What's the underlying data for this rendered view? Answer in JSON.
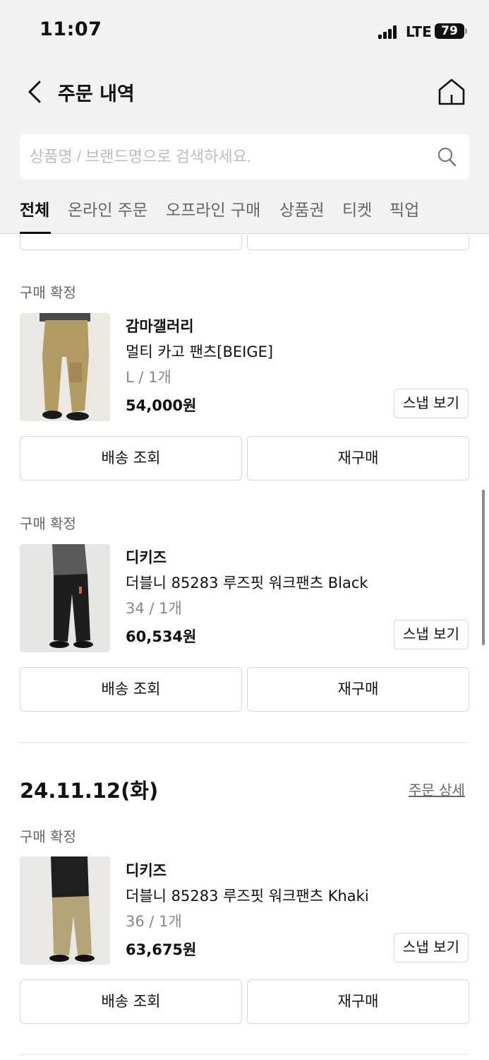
{
  "status_bar": {
    "time": "11:07",
    "network": "LTE",
    "battery": "79"
  },
  "header": {
    "title": "주문 내역"
  },
  "search": {
    "placeholder": "상품명 / 브랜드명으로 검색하세요."
  },
  "tabs": [
    {
      "label": "전체",
      "active": true
    },
    {
      "label": "온라인 주문",
      "active": false
    },
    {
      "label": "오프라인 구매",
      "active": false
    },
    {
      "label": "상품권",
      "active": false
    },
    {
      "label": "티켓",
      "active": false
    },
    {
      "label": "픽업",
      "active": false
    }
  ],
  "items": [
    {
      "status": "구매 확정",
      "brand": "감마갤러리",
      "name": "멀티 카고 팬츠[BEIGE]",
      "option": "L / 1개",
      "price": "54,000원",
      "snap_label": "스냅 보기",
      "track_label": "배송 조회",
      "rebuy_label": "재구매"
    },
    {
      "status": "구매 확정",
      "brand": "디키즈",
      "name": "더블니 85283 루즈핏 워크팬츠 Black",
      "option": "34 / 1개",
      "price": "60,534원",
      "snap_label": "스냅 보기",
      "track_label": "배송 조회",
      "rebuy_label": "재구매"
    }
  ],
  "order_group": {
    "date": "24.11.12(화)",
    "detail_label": "주문 상세",
    "items": [
      {
        "status": "구매 확정",
        "brand": "디키즈",
        "name": "더블니 85283 루즈핏 워크팬츠 Khaki",
        "option": "36 / 1개",
        "price": "63,675원",
        "snap_label": "스냅 보기",
        "track_label": "배송 조회",
        "rebuy_label": "재구매"
      }
    ]
  },
  "colors": {
    "background": "#f2f2f2",
    "text": "#111111",
    "muted": "#666666",
    "border": "#d7d7d7"
  }
}
